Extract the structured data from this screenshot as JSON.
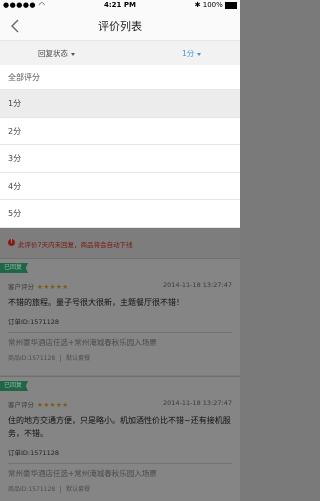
{
  "status_bar": {
    "carrier": "●●●●●",
    "wifi_icon": "wifi-icon",
    "time": "4:21 PM",
    "bluetooth": "✱",
    "battery": "100%"
  },
  "nav": {
    "title": "评价列表",
    "back_icon": "chevron-left-icon"
  },
  "filters": {
    "reply_status": "回复状态",
    "rating": "1分"
  },
  "dropdown": {
    "options": [
      "全部评分",
      "1分",
      "2分",
      "3分",
      "4分",
      "5分"
    ],
    "selected_index": 1
  },
  "warning": {
    "icon": "exclamation-icon",
    "text": "此评价7天内未回复，商品将会自动下线"
  },
  "reviews": [
    {
      "tag": "已回复",
      "author": "客户评分",
      "stars": "★★★★★",
      "date": "2014-11-18  13:27:47",
      "content": "不错的旅程。量子号很大很新，主题餐厅很不错！",
      "order": "订单ID:1571128",
      "hotel": "常州豪华酒店任选+常州淹城春秋乐园入场票",
      "product_id": "商品ID:1571128",
      "product_type": "默认套餐"
    },
    {
      "tag": "已回复",
      "author": "客户评分",
      "stars": "★★★★★",
      "date": "2014-11-18  13:27:47",
      "content": "住的地方交通方便，只是略小。机加酒性价比不错~还有接机服务，不错。",
      "order": "订单ID:1571128",
      "hotel": "常州豪华酒店任选+常州淹城春秋乐园入场票",
      "product_id": "商品ID:1571128",
      "product_type": "默认套餐"
    }
  ]
}
